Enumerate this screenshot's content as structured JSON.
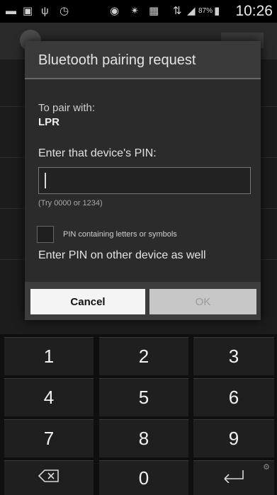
{
  "status_bar": {
    "time": "10:26",
    "battery_percent": "87%",
    "icons": [
      "notification-icon",
      "image-icon",
      "usb-icon",
      "alarm-icon",
      "eye-icon",
      "bluetooth-icon",
      "nfc-icon",
      "signal-icon",
      "battery-icon"
    ]
  },
  "dialog": {
    "title": "Bluetooth pairing request",
    "pair_with_label": "To pair with:",
    "device_name": "LPR",
    "enter_pin_label": "Enter that device's PIN:",
    "pin_value": "",
    "hint": "(Try 0000 or 1234)",
    "checkbox_label": "PIN containing letters or symbols",
    "other_device_note": "Enter PIN on other device as well",
    "cancel_label": "Cancel",
    "ok_label": "OK"
  },
  "keypad": {
    "keys": [
      "1",
      "2",
      "3",
      "4",
      "5",
      "6",
      "7",
      "8",
      "9",
      "0"
    ],
    "backspace_icon": "backspace-icon",
    "enter_icon": "enter-icon"
  }
}
